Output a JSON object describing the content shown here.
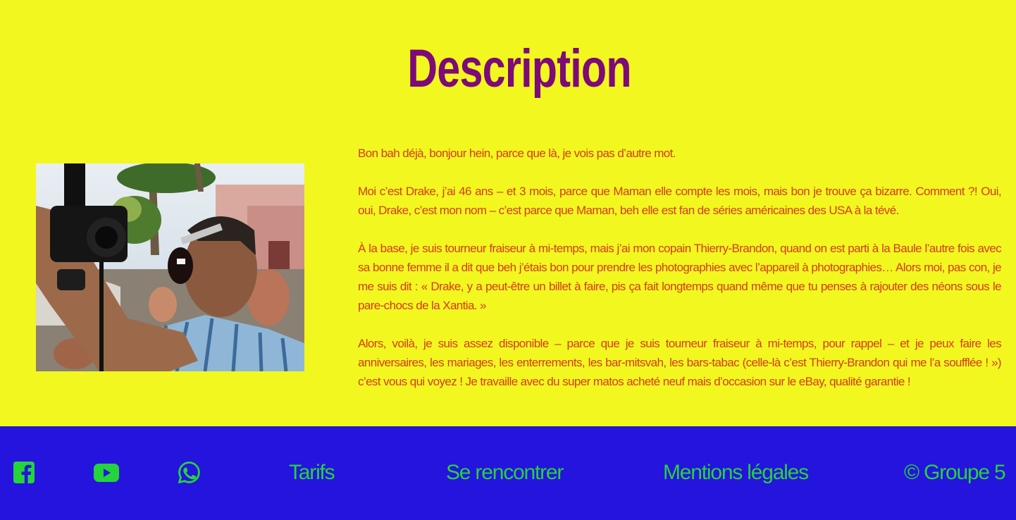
{
  "heading": {
    "title": "Description"
  },
  "colors": {
    "background": "#f2f71f",
    "title": "#7d0a78",
    "body_text": "#d63c1e",
    "footer_background": "#2513de",
    "footer_links": "#25d33b"
  },
  "photo": {
    "description": "photographer-with-camera",
    "icon": "photo-image"
  },
  "description": {
    "paragraphs": [
      "Bon bah déjà, bonjour hein, parce que là, je vois pas d’autre mot.",
      "Moi c’est Drake, j’ai 46 ans – et 3 mois, parce que Maman elle compte les mois, mais bon je trouve ça bizarre. Comment ?! Oui, oui, Drake, c’est mon nom – c’est parce que Maman, beh elle est fan de séries américaines des USA à la tévé.",
      "À la base, je suis tourneur fraiseur à mi-temps, mais j’ai mon copain Thierry-Brandon, quand on est parti à la Baule l’autre fois avec sa bonne femme il a dit que beh j’étais bon pour prendre les photographies avec l’appareil à photographies… Alors moi, pas con, je me suis dit : « Drake, y a peut-être un billet à faire, pis ça fait longtemps quand même que tu penses à rajouter des néons sous le pare-chocs de la Xantia. »",
      "Alors, voilà, je suis assez disponible – parce que je suis tourneur fraiseur à mi-temps, pour rappel – et je peux faire les anniversaires, les mariages, les enterrements, les bar-mitsvah, les bars-tabac (celle-là c’est Thierry-Brandon qui me l’a soufflée ! ») c’est vous qui voyez ! Je travaille avec du super matos acheté neuf mais d’occasion sur le eBay, qualité garantie !"
    ]
  },
  "footer": {
    "icons": [
      "facebook-icon",
      "youtube-icon",
      "whatsapp-icon"
    ],
    "links": {
      "tarifs": "Tarifs",
      "rencontrer": "Se rencontrer",
      "mentions": "Mentions légales",
      "copyright": "© Groupe 5"
    }
  }
}
